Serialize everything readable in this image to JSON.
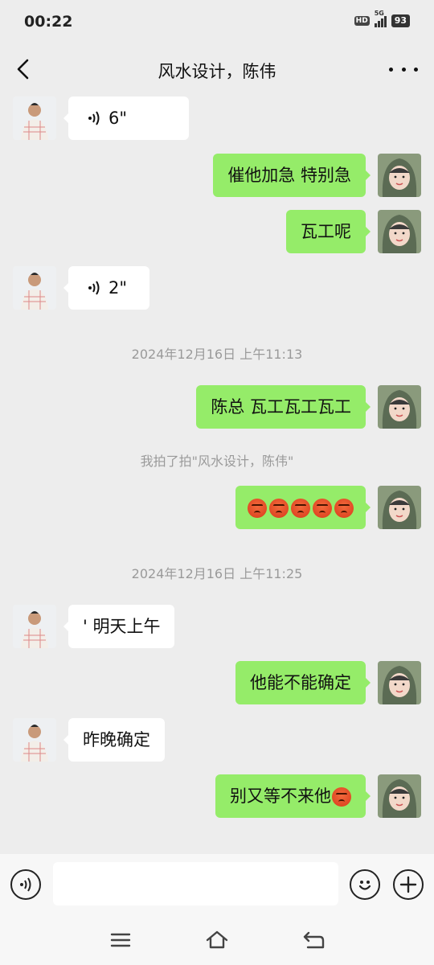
{
  "status_bar": {
    "time": "00:22",
    "hd": "HD",
    "network": "5G",
    "battery": "93"
  },
  "header": {
    "title": "风水设计，陈伟"
  },
  "messages": [
    {
      "side": "in",
      "kind": "voice",
      "text": "6\""
    },
    {
      "side": "out",
      "kind": "text",
      "text": "催他加急  特别急"
    },
    {
      "side": "out",
      "kind": "text",
      "text": "瓦工呢"
    },
    {
      "side": "in",
      "kind": "voice",
      "text": "2\""
    },
    {
      "side": "system",
      "text": "2024年12月16日 上午11:13"
    },
    {
      "side": "out",
      "kind": "text",
      "text": "陈总 瓦工瓦工瓦工"
    },
    {
      "side": "system",
      "text": "我拍了拍\"风水设计，陈伟\""
    },
    {
      "side": "out",
      "kind": "emoji",
      "emoji": "angry-face",
      "count": 5
    },
    {
      "side": "system",
      "text": "2024年12月16日 上午11:25"
    },
    {
      "side": "in",
      "kind": "text",
      "text": "' 明天上午"
    },
    {
      "side": "out",
      "kind": "text",
      "text": "他能不能确定"
    },
    {
      "side": "in",
      "kind": "text",
      "text": "昨晚确定"
    },
    {
      "side": "out",
      "kind": "text",
      "text": "别又等不来他",
      "emoji": "angry-face"
    }
  ],
  "input_bar": {
    "value": "",
    "voice_icon": "voice-input-icon",
    "emoji_icon": "emoji-icon",
    "plus_icon": "plus-icon"
  },
  "system_nav": {
    "menu_icon": "menu-icon",
    "home_icon": "home-icon",
    "back_icon": "back-icon"
  },
  "colors": {
    "background": "#ededed",
    "bubble_out": "#95ec69",
    "bubble_in": "#ffffff",
    "system_text": "#9a9a9a"
  }
}
